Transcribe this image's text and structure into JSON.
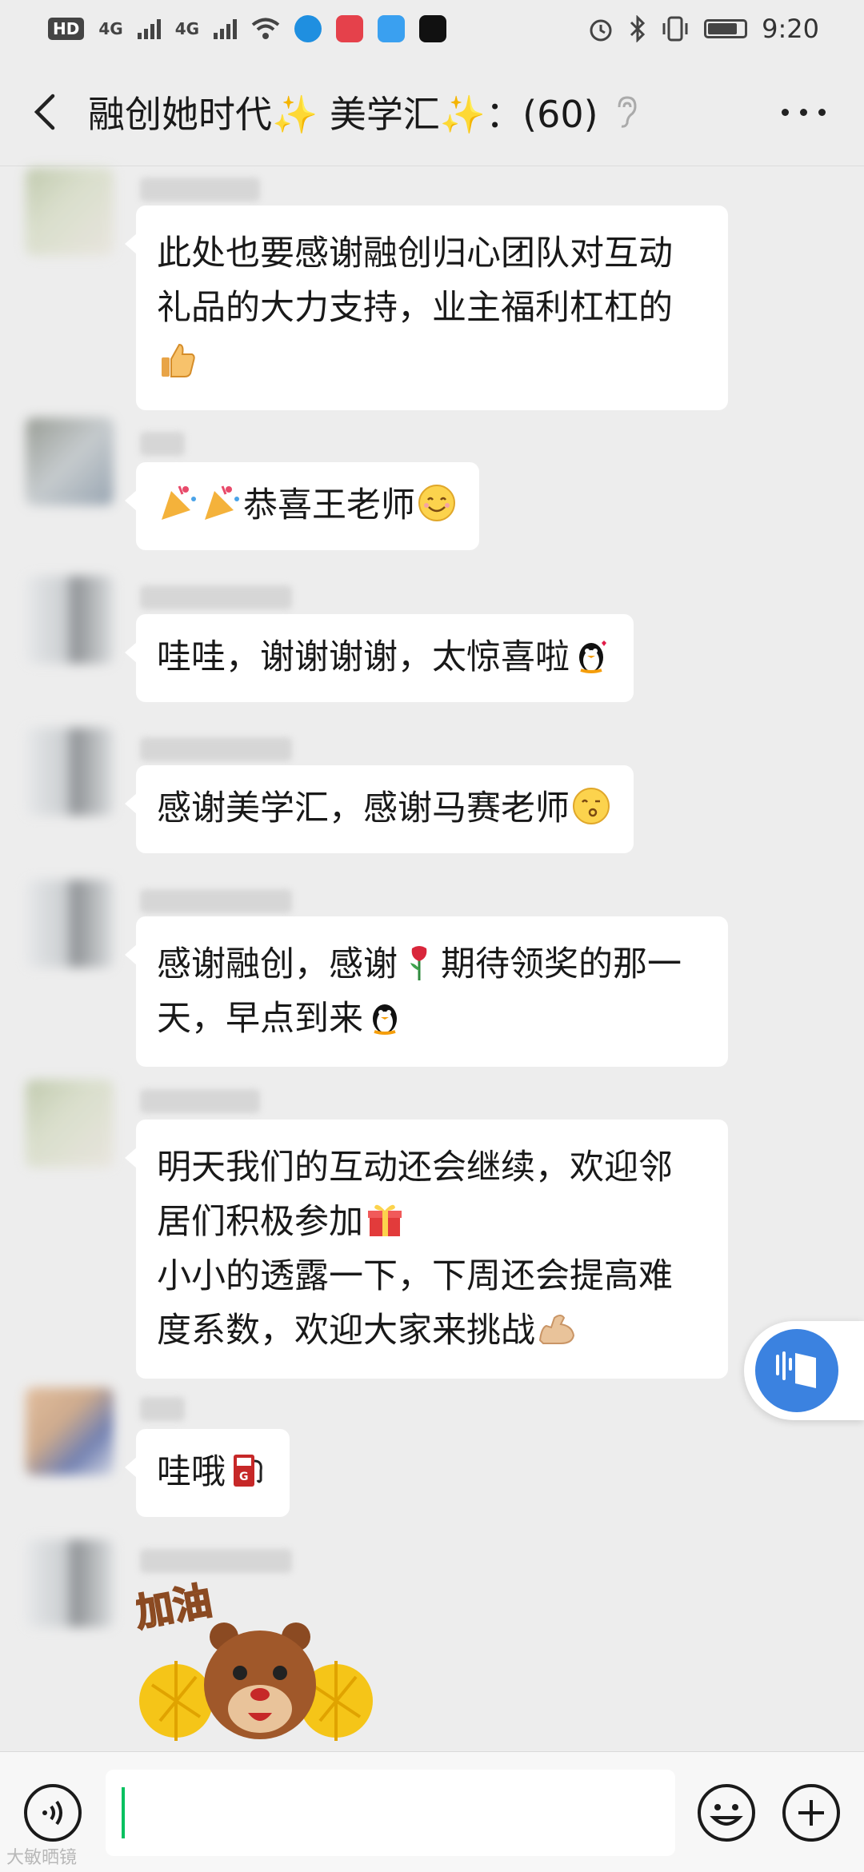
{
  "status_bar": {
    "hd_label": "HD",
    "network_1": "4G",
    "network_2": "4G",
    "time": "9:20"
  },
  "header": {
    "title": "融创她时代✨ 美学汇✨：(60)",
    "back_icon": "chevron-left-icon",
    "mute_icon": "ear-muted-icon",
    "more_icon": "more-dots-icon"
  },
  "messages": [
    {
      "text": "此处也要感谢融创归心团队对互动\n礼品的大力支持，业主福利杠杠的",
      "trailing_emoji": "thumbs-up"
    },
    {
      "text": "恭喜王老师",
      "leading_emoji": "party-popper x2",
      "trailing_emoji": "smile"
    },
    {
      "text": "哇哇，谢谢谢谢，太惊喜啦",
      "trailing_emoji": "penguin-kiss"
    },
    {
      "text": "感谢美学汇，感谢马赛老师",
      "trailing_emoji": "kiss-face"
    },
    {
      "text_a": "感谢融创，感谢",
      "emoji_mid": "rose",
      "text_b": "期待领奖的那一\n天，早点到来",
      "trailing_emoji": "penguin"
    },
    {
      "text_a": "明天我们的互动还会继续，欢迎邻\n居们积极参加",
      "emoji_mid": "gift",
      "text_b": "\n小小的透露一下，下周还会提高难\n度系数，欢迎大家来挑战",
      "trailing_emoji": "flexed-bicep"
    },
    {
      "text": "哇哦",
      "trailing_emoji": "fuel-pump"
    },
    {
      "sticker": "bear-cheering-sticker",
      "sticker_text": "加油"
    }
  ],
  "input_bar": {
    "voice_icon": "voice-icon",
    "emoji_icon": "emoji-icon",
    "plus_icon": "plus-icon"
  },
  "watermark": "大敏晒镜"
}
